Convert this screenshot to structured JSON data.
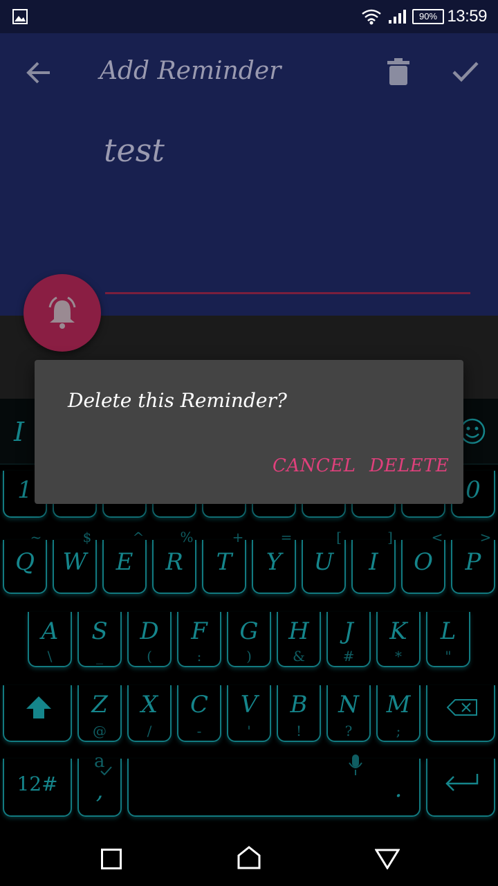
{
  "status_bar": {
    "time": "13:59",
    "battery": "90%"
  },
  "app_bar": {
    "title": "Add Reminder"
  },
  "reminder": {
    "text": "test"
  },
  "dialog": {
    "message": "Delete this Reminder?",
    "cancel_label": "CANCEL",
    "delete_label": "DELETE"
  },
  "keyboard": {
    "partial_left": "I",
    "number_row_visible": [
      "1",
      "0"
    ],
    "row1": [
      {
        "main": "Q",
        "hint": "~"
      },
      {
        "main": "W",
        "hint": "$"
      },
      {
        "main": "E",
        "hint": "^"
      },
      {
        "main": "R",
        "hint": "%"
      },
      {
        "main": "T",
        "hint": "+"
      },
      {
        "main": "Y",
        "hint": "="
      },
      {
        "main": "U",
        "hint": "["
      },
      {
        "main": "I",
        "hint": "]"
      },
      {
        "main": "O",
        "hint": "<"
      },
      {
        "main": "P",
        "hint": ">"
      }
    ],
    "row2": [
      {
        "main": "A",
        "sec": "\\"
      },
      {
        "main": "S",
        "sec": "_"
      },
      {
        "main": "D",
        "sec": "("
      },
      {
        "main": "F",
        "sec": ":"
      },
      {
        "main": "G",
        "sec": ")"
      },
      {
        "main": "H",
        "sec": "&"
      },
      {
        "main": "J",
        "sec": "#"
      },
      {
        "main": "K",
        "sec": "*"
      },
      {
        "main": "L",
        "sec": "\""
      }
    ],
    "row3": [
      {
        "main": "Z",
        "sec": "@"
      },
      {
        "main": "X",
        "sec": "/"
      },
      {
        "main": "C",
        "sec": "-"
      },
      {
        "main": "V",
        "sec": "'"
      },
      {
        "main": "B",
        "sec": "!"
      },
      {
        "main": "N",
        "sec": "?"
      },
      {
        "main": "M",
        "sec": ";"
      }
    ],
    "symbols_label": "12#",
    "comma_label": ",",
    "period_label": "."
  },
  "colors": {
    "accent": "#e0407c",
    "keyboard": "#15858b",
    "app_bar": "#18204f",
    "fab": "#8a1e43"
  }
}
